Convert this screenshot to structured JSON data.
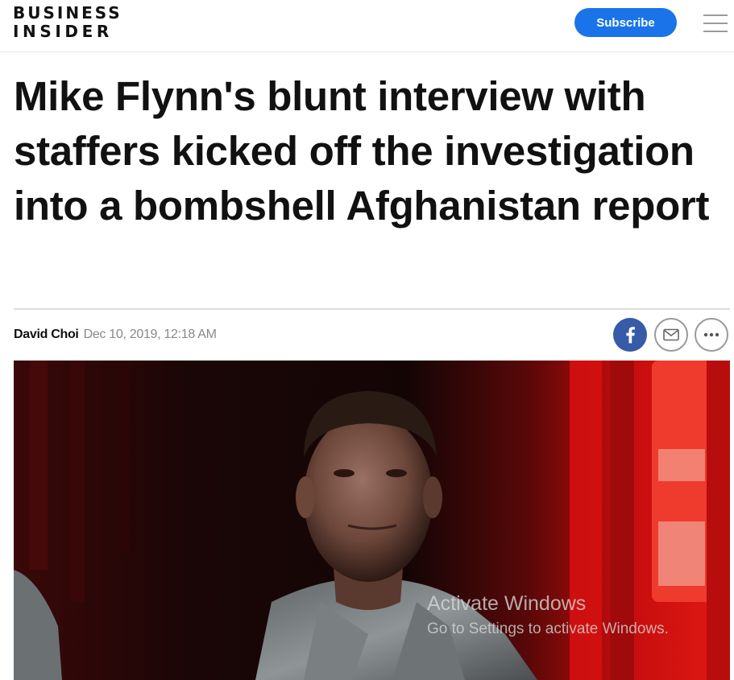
{
  "header": {
    "logo_line1": "BUSINESS",
    "logo_line2": "INSIDER",
    "subscribe_label": "Subscribe",
    "menu_icon": "hamburger-menu-icon",
    "accent_color": "#1a73e8"
  },
  "article": {
    "headline": "Mike Flynn's blunt interview with staffers kicked off the investigation into a bombshell Afghanistan report",
    "author": "David Choi",
    "date": "Dec 10, 2019, 12:18 AM"
  },
  "share": {
    "facebook_icon": "facebook-icon",
    "email_icon": "email-icon",
    "more_icon": "more-dots-icon",
    "facebook_color": "#365ba7"
  },
  "overlay": {
    "activate_title": "Activate Windows",
    "activate_subtitle": "Go to Settings to activate Windows."
  }
}
